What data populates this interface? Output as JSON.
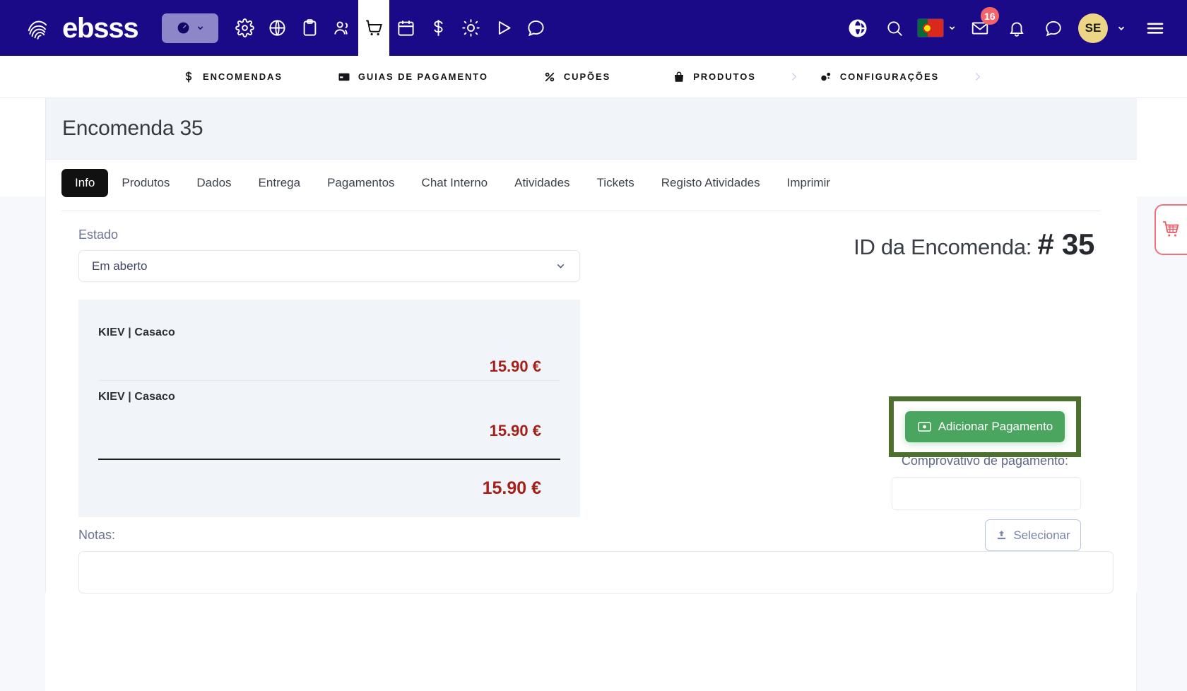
{
  "topbar": {
    "brand": "ebsss",
    "brand_icon": "fingerprint-logo-icon",
    "dashboard_pill": {
      "icon": "speedometer-icon",
      "chevron": "chevron-down-icon"
    },
    "icons": [
      {
        "name": "gear-icon",
        "active": false
      },
      {
        "name": "globe-icon",
        "active": false
      },
      {
        "name": "clipboard-icon",
        "active": false
      },
      {
        "name": "users-icon",
        "active": false
      },
      {
        "name": "shopping-cart-icon",
        "active": true
      },
      {
        "name": "calendar-icon",
        "active": false
      },
      {
        "name": "dollar-icon",
        "active": false
      },
      {
        "name": "sun-icon",
        "active": false
      },
      {
        "name": "play-icon",
        "active": false
      },
      {
        "name": "chat-bubble-icon",
        "active": false
      }
    ],
    "right": {
      "globe_icon": "globe-icon",
      "search_icon": "search-icon",
      "language_flag": "portugal-flag",
      "mail_icon": "envelope-icon",
      "mail_badge": "16",
      "bell_icon": "bell-icon",
      "chat_icon": "chat-bubble-icon",
      "avatar_initials": "SE",
      "menu_icon": "hamburger-menu-icon"
    }
  },
  "subnav": {
    "items": [
      {
        "label": "ENCOMENDAS",
        "icon": "dollar-icon"
      },
      {
        "label": "GUIAS DE PAGAMENTO",
        "icon": "credit-card-icon"
      },
      {
        "label": "CUPÕES",
        "icon": "percent-icon"
      },
      {
        "label": "PRODUTOS",
        "icon": "bag-icon"
      },
      {
        "label": "CONFIGURAÇÕES",
        "icon": "settings-sliders-icon"
      }
    ]
  },
  "page": {
    "title": "Encomenda 35"
  },
  "tabs": [
    {
      "label": "Info",
      "active": true
    },
    {
      "label": "Produtos",
      "active": false
    },
    {
      "label": "Dados",
      "active": false
    },
    {
      "label": "Entrega",
      "active": false
    },
    {
      "label": "Pagamentos",
      "active": false
    },
    {
      "label": "Chat Interno",
      "active": false
    },
    {
      "label": "Atividades",
      "active": false
    },
    {
      "label": "Tickets",
      "active": false
    },
    {
      "label": "Registo Atividades",
      "active": false
    },
    {
      "label": "Imprimir",
      "active": false
    }
  ],
  "form": {
    "estado_label": "Estado",
    "estado_value": "Em aberto",
    "notas_label": "Notas:"
  },
  "items": [
    {
      "name": "KIEV | Casaco",
      "price": "15.90 €"
    },
    {
      "name": "KIEV | Casaco",
      "price": "15.90 €"
    }
  ],
  "total": "15.90 €",
  "side": {
    "order_id_label": "ID da Encomenda:",
    "order_id_value": "# 35",
    "add_payment_button": "Adicionar Pagamento",
    "add_payment_icon": "banknote-icon",
    "proof_label": "Comprovativo de pagamento:",
    "proof_value": "",
    "select_button": "Selecionar",
    "select_icon": "upload-icon"
  },
  "cart_fab": {
    "icon": "shopping-cart-icon"
  },
  "colors": {
    "navy": "#1a0a87",
    "accent_green": "#4aa55e",
    "highlight_border": "#4d702e",
    "price_red": "#a52019",
    "badge_red": "#f2646b",
    "avatar_gold": "#ecd585",
    "cart_fab": "#ef737d"
  }
}
